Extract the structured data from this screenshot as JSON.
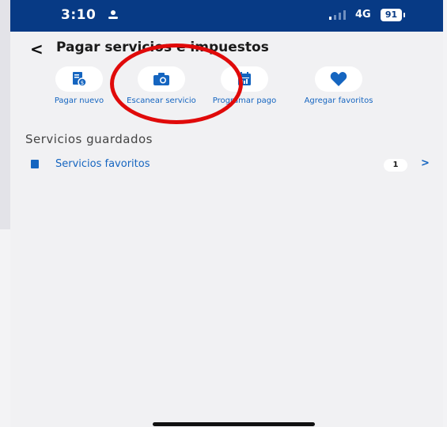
{
  "status_bar": {
    "time": "3:10",
    "network": "4G",
    "battery": "91",
    "icons": [
      "person-icon",
      "signal-icon"
    ]
  },
  "header": {
    "back_icon": "chevron-left",
    "title": "Pagar servicios e impuestos"
  },
  "actions": [
    {
      "label": "Pagar nuevo",
      "icon": "new-bill-icon"
    },
    {
      "label": "Escanear servicio",
      "icon": "camera-icon"
    },
    {
      "label": "Programar pago",
      "icon": "calendar-icon"
    },
    {
      "label": "Agregar favoritos",
      "icon": "heart-icon"
    }
  ],
  "section": {
    "title": "Servicios guardados"
  },
  "favorites_row": {
    "label": "Servicios favoritos",
    "count": "1",
    "icon": "list-icon",
    "chevron": ">"
  },
  "colors": {
    "status_bar": "#073a85",
    "accent": "#1565c0",
    "annotation": "#e00a0a",
    "background": "#f1f1f3"
  }
}
